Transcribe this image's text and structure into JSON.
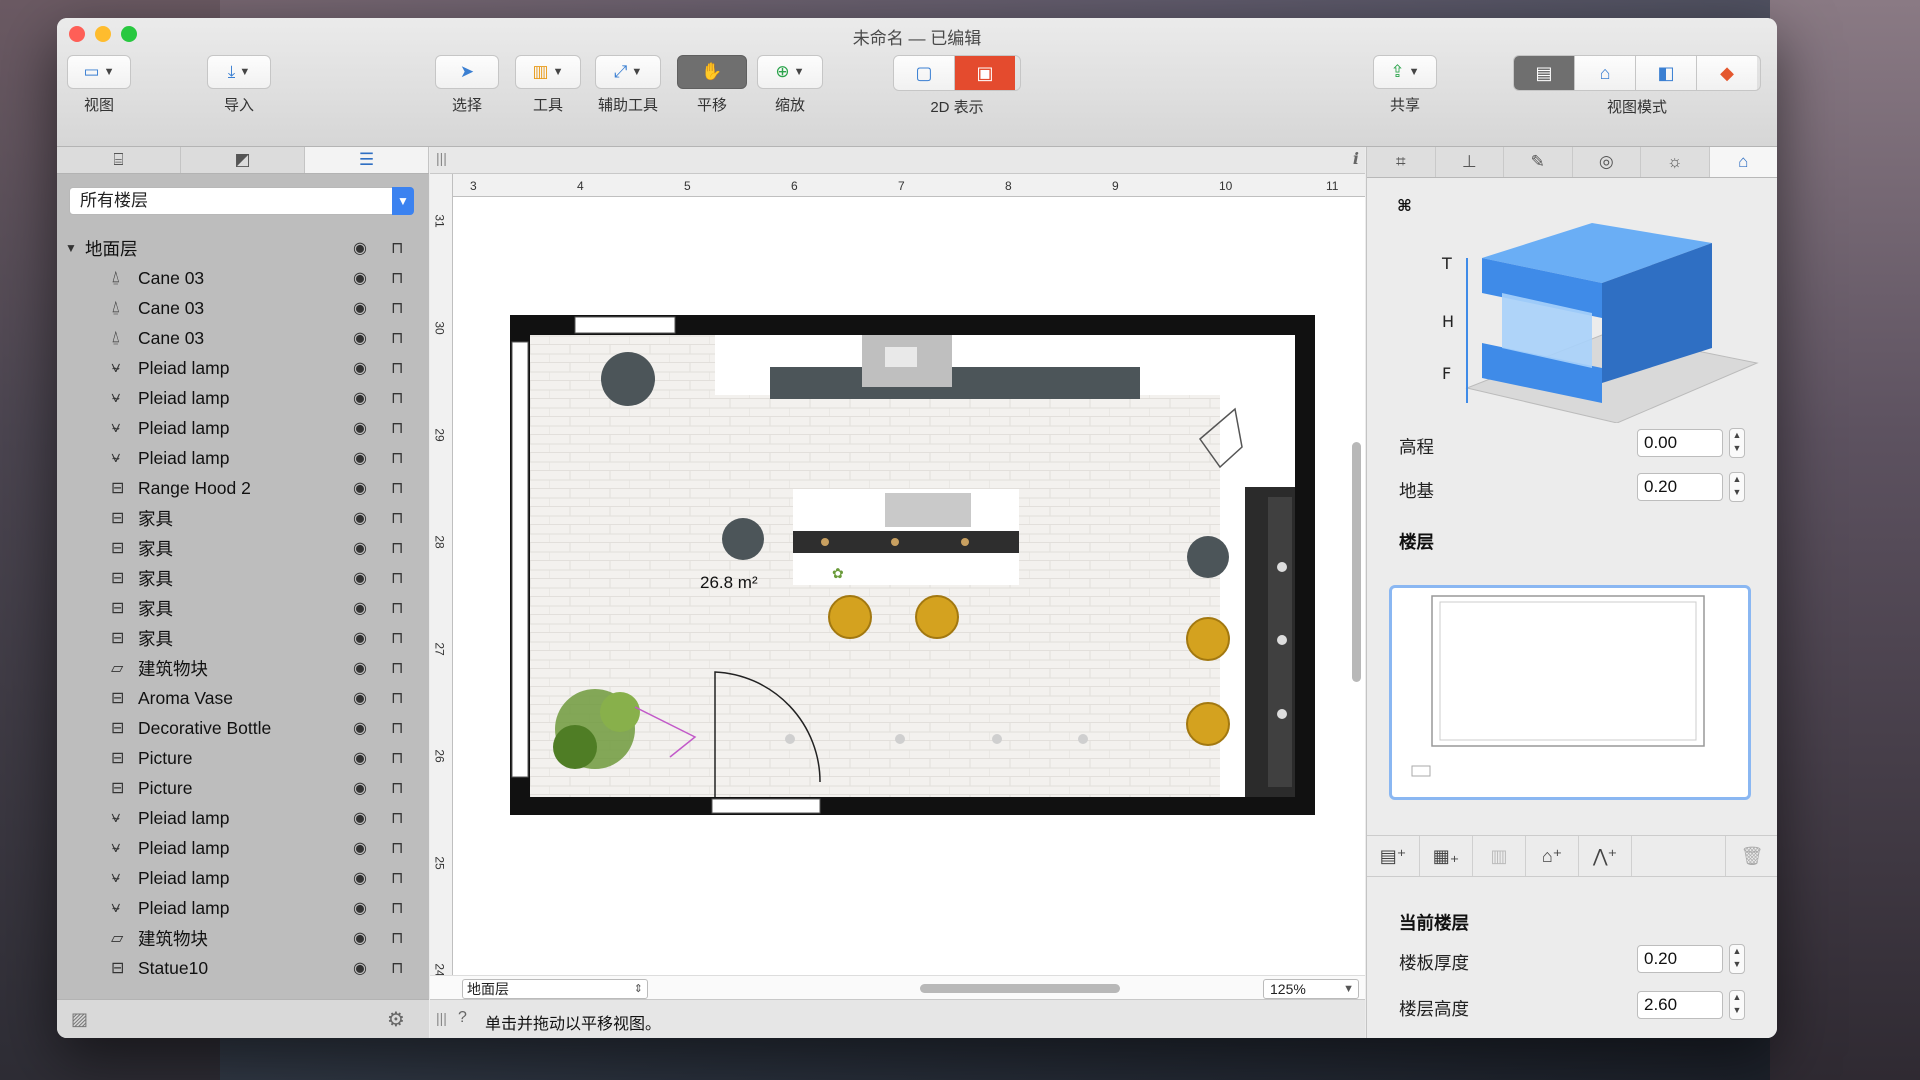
{
  "window": {
    "title": "未命名 — 已编辑"
  },
  "toolbar": {
    "view": "视图",
    "import": "导入",
    "select": "选择",
    "tools": "工具",
    "aux_tools": "辅助工具",
    "pan": "平移",
    "zoom": "缩放",
    "display_2d": "2D 表示",
    "share": "共享",
    "view_mode": "视图模式"
  },
  "left_panel": {
    "floor_filter": "所有楼层",
    "group_name": "地面层",
    "items": [
      {
        "icon": "lamp-icon",
        "name": "Cane 03"
      },
      {
        "icon": "lamp-icon",
        "name": "Cane 03"
      },
      {
        "icon": "lamp-icon",
        "name": "Cane 03"
      },
      {
        "icon": "desk-lamp-icon",
        "name": "Pleiad lamp"
      },
      {
        "icon": "desk-lamp-icon",
        "name": "Pleiad lamp"
      },
      {
        "icon": "desk-lamp-icon",
        "name": "Pleiad lamp"
      },
      {
        "icon": "desk-lamp-icon",
        "name": "Pleiad lamp"
      },
      {
        "icon": "furniture-icon",
        "name": "Range Hood 2"
      },
      {
        "icon": "furniture-icon",
        "name": "家具"
      },
      {
        "icon": "furniture-icon",
        "name": "家具"
      },
      {
        "icon": "furniture-icon",
        "name": "家具"
      },
      {
        "icon": "furniture-icon",
        "name": "家具"
      },
      {
        "icon": "furniture-icon",
        "name": "家具"
      },
      {
        "icon": "block-icon",
        "name": "建筑物块"
      },
      {
        "icon": "furniture-icon",
        "name": "Aroma Vase"
      },
      {
        "icon": "furniture-icon",
        "name": "Decorative Bottle"
      },
      {
        "icon": "furniture-icon",
        "name": "Picture"
      },
      {
        "icon": "furniture-icon",
        "name": "Picture"
      },
      {
        "icon": "desk-lamp-icon",
        "name": "Pleiad lamp"
      },
      {
        "icon": "desk-lamp-icon",
        "name": "Pleiad lamp"
      },
      {
        "icon": "desk-lamp-icon",
        "name": "Pleiad lamp"
      },
      {
        "icon": "desk-lamp-icon",
        "name": "Pleiad lamp"
      },
      {
        "icon": "block-icon",
        "name": "建筑物块"
      },
      {
        "icon": "furniture-icon",
        "name": "Statue10"
      }
    ]
  },
  "canvas": {
    "ruler_unit": "m",
    "ruler_h": [
      "3",
      "4",
      "5",
      "6",
      "7",
      "8",
      "9",
      "10",
      "11"
    ],
    "ruler_v": [
      "31",
      "30",
      "29",
      "28",
      "27",
      "26",
      "25",
      "24"
    ],
    "area_label": "26.8 m²",
    "level": "地面层",
    "zoom": "125%",
    "status_message": "单击并拖动以平移视图。"
  },
  "right_panel": {
    "diagram_labels": [
      "T",
      "H",
      "F"
    ],
    "elevation_label": "高程",
    "elevation_value": "0.00",
    "foundation_label": "地基",
    "foundation_value": "0.20",
    "floors_heading": "楼层",
    "current_floor_heading": "当前楼层",
    "slab_thickness_label": "楼板厚度",
    "slab_thickness_value": "0.20",
    "floor_height_label": "楼层高度",
    "floor_height_value": "2.60"
  },
  "colors": {
    "accent": "#3b82f0",
    "wall": "#111111",
    "stool_yellow": "#d4a21f",
    "stool_dark": "#4c5559",
    "box_blue": "#3f8be8"
  }
}
